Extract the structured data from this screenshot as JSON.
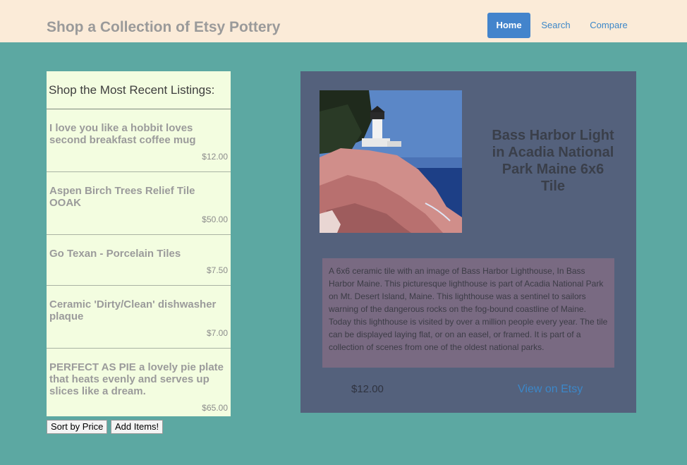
{
  "header": {
    "brand": "Shop a Collection of Etsy Pottery",
    "nav": [
      {
        "label": "Home",
        "active": true
      },
      {
        "label": "Search",
        "active": false
      },
      {
        "label": "Compare",
        "active": false
      }
    ]
  },
  "sidebar": {
    "heading": "Shop the Most Recent Listings:",
    "items": [
      {
        "title": "I love you like a hobbit loves second breakfast coffee mug",
        "price": "$12.00"
      },
      {
        "title": "Aspen Birch Trees Relief Tile OOAK",
        "price": "$50.00"
      },
      {
        "title": "Go Texan - Porcelain Tiles",
        "price": "$7.50"
      },
      {
        "title": "Ceramic 'Dirty/Clean' dishwasher plaque",
        "price": "$7.00"
      },
      {
        "title": "PERFECT AS PIE a lovely pie plate that heats evenly and serves up slices like a dream.",
        "price": "$65.00"
      }
    ],
    "sort_label": "Sort by Price",
    "add_label": "Add Items!"
  },
  "detail": {
    "title": "Bass Harbor Light in Acadia National Park Maine 6x6 Tile",
    "image_caption": "Bass Harbor Light Acadia National Park",
    "description": "A 6x6 ceramic tile with an image of Bass Harbor Lighthouse, In Bass Harbor Maine. This picturesque lighthouse is part of Acadia National Park on Mt. Desert Island, Maine. This lighthouse was a sentinel to sailors warning of the dangerous rocks on the fog-bound coastline of Maine. Today this lighthouse is visited by over a million people every year. The tile can be displayed laying flat, or on an easel, or framed. It is part of a collection of scenes from one of the oldest national parks.",
    "price": "$12.00",
    "link_label": "View on Etsy"
  }
}
